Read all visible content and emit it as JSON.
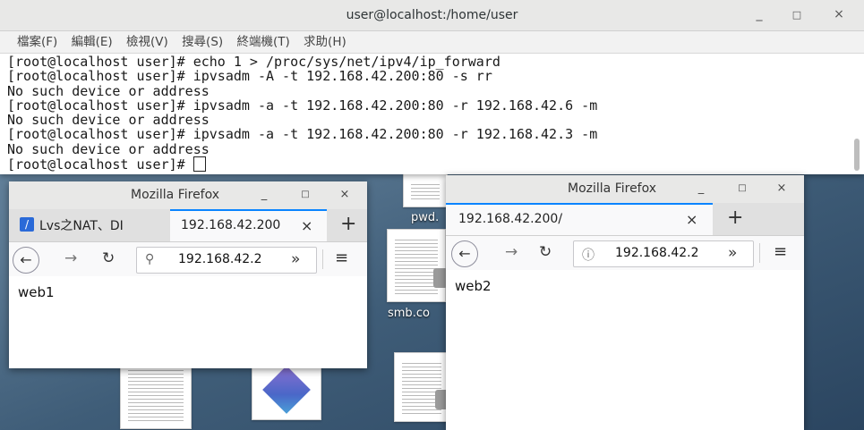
{
  "desktop": {
    "icons": [
      {
        "label": "pwd."
      },
      {
        "label": "smb.co"
      }
    ]
  },
  "terminal": {
    "title": "user@localhost:/home/user",
    "menu": [
      "檔案(F)",
      "編輯(E)",
      "檢視(V)",
      "搜尋(S)",
      "終端機(T)",
      "求助(H)"
    ],
    "lines": [
      "[root@localhost user]# echo 1 > /proc/sys/net/ipv4/ip_forward",
      "[root@localhost user]# ipvsadm -A -t 192.168.42.200:80 -s rr",
      "No such device or address",
      "[root@localhost user]# ipvsadm -a -t 192.168.42.200:80 -r 192.168.42.6 -m",
      "No such device or address",
      "[root@localhost user]# ipvsadm -a -t 192.168.42.200:80 -r 192.168.42.3 -m",
      "No such device or address"
    ],
    "prompt": "[root@localhost user]# "
  },
  "firefox1": {
    "title": "Mozilla Firefox",
    "tab1": "Lvs之NAT、DI",
    "tab2": "192.168.42.200",
    "url": "192.168.42.2",
    "content": "web1"
  },
  "firefox2": {
    "title": "Mozilla Firefox",
    "tab1": "192.168.42.200/",
    "url": "192.168.42.2",
    "content": "web2"
  },
  "colors": {
    "tab_accent": "#0a84ff",
    "titlebar": "#e8e8e7"
  }
}
